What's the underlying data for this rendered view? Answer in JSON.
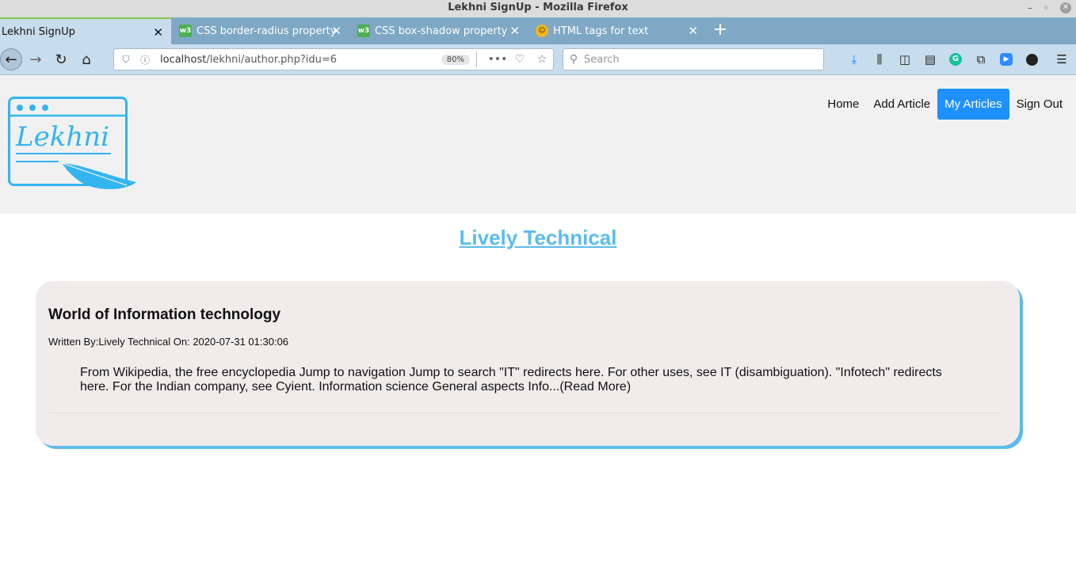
{
  "browser": {
    "window_title": "Lekhni SignUp - Mozilla Firefox",
    "window_controls": {
      "minimize": "–",
      "maximize": "◦",
      "close": "✕"
    },
    "tabs": [
      {
        "label": "Lekhni SignUp",
        "active": true,
        "favicon": "none"
      },
      {
        "label": "CSS border-radius property",
        "active": false,
        "favicon": "w3"
      },
      {
        "label": "CSS box-shadow property",
        "active": false,
        "favicon": "w3"
      },
      {
        "label": "HTML tags for text",
        "active": false,
        "favicon": "face"
      }
    ],
    "tab_close_glyph": "✕",
    "new_tab_glyph": "+",
    "url": {
      "host": "localhost",
      "path": "/lekhni/author.php?idu=6",
      "zoom": "80%"
    },
    "search_placeholder": "Search"
  },
  "site": {
    "logo_text": "Lekhni",
    "nav": [
      {
        "label": "Home",
        "active": false
      },
      {
        "label": "Add Article",
        "active": false
      },
      {
        "label": "My Articles",
        "active": true
      },
      {
        "label": "Sign Out",
        "active": false
      }
    ],
    "accent_color": "#5bbcec",
    "active_nav_color": "#1e90ff"
  },
  "author": {
    "name": "Lively Technical"
  },
  "articles": [
    {
      "title": "World of Information technology",
      "meta": "Written By:Lively Technical On: 2020-07-31 01:30:06",
      "excerpt": "From Wikipedia, the free encyclopedia Jump to navigation Jump to search \"IT\" redirects here. For other uses, see IT (disambiguation). \"Infotech\" redirects here. For the Indian company, see Cyient. Information science General aspects Info...(Read More)"
    }
  ]
}
